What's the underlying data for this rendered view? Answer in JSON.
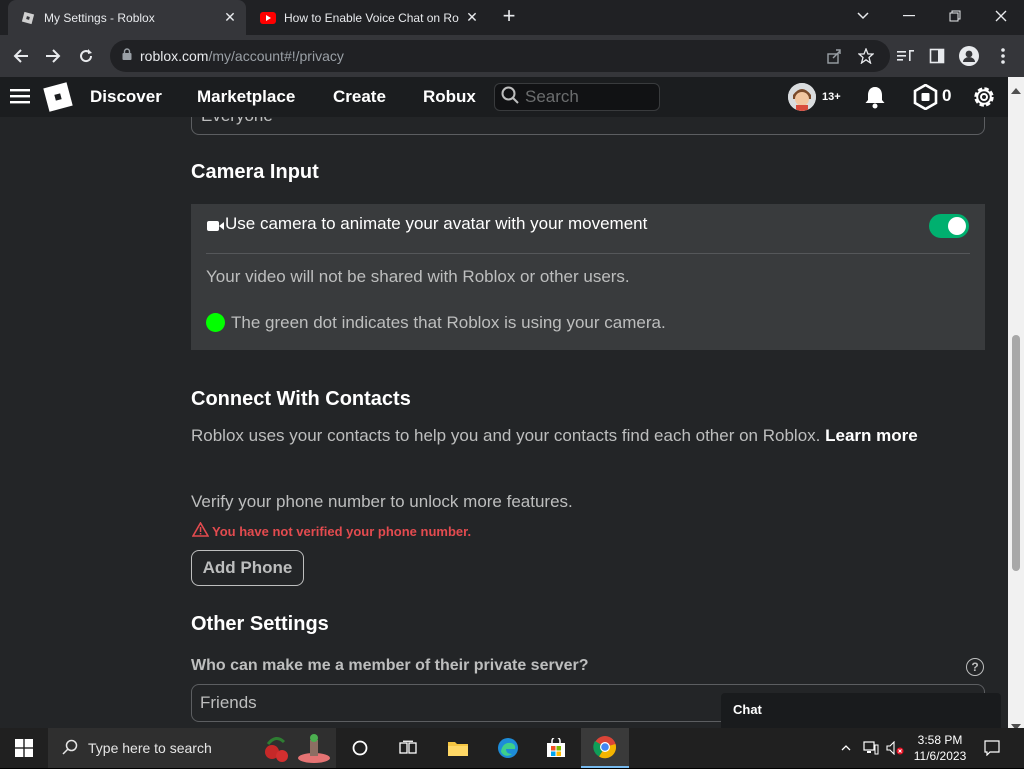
{
  "browser": {
    "tabs": [
      {
        "title": "My Settings - Roblox",
        "active": true
      },
      {
        "title": "How to Enable Voice Chat on Ro",
        "active": false
      }
    ],
    "url_host": "roblox.com",
    "url_path": "/my/account#!/privacy"
  },
  "header": {
    "nav": [
      "Discover",
      "Marketplace",
      "Create",
      "Robux"
    ],
    "search_placeholder": "Search",
    "age_badge": "13+",
    "robux_count": "0"
  },
  "page": {
    "top_select_value": "Everyone",
    "camera": {
      "heading": "Camera Input",
      "toggle_label": "Use camera to animate your avatar with your movement",
      "toggle_on": true,
      "note": "Your video will not be shared with Roblox or other users.",
      "dot_note": "The green dot indicates that Roblox is using your camera."
    },
    "contacts": {
      "heading": "Connect With Contacts",
      "description": "Roblox uses your contacts to help you and your contacts find each other on Roblox.",
      "learn_more": "Learn more",
      "verify_text": "Verify your phone number to unlock more features.",
      "warning": "You have not verified your phone number.",
      "add_phone": "Add Phone"
    },
    "other": {
      "heading": "Other Settings",
      "question": "Who can make me a member of their private server?",
      "select_value": "Friends"
    },
    "chat_label": "Chat"
  },
  "taskbar": {
    "search_placeholder": "Type here to search",
    "time": "3:58 PM",
    "date": "11/6/2023"
  }
}
